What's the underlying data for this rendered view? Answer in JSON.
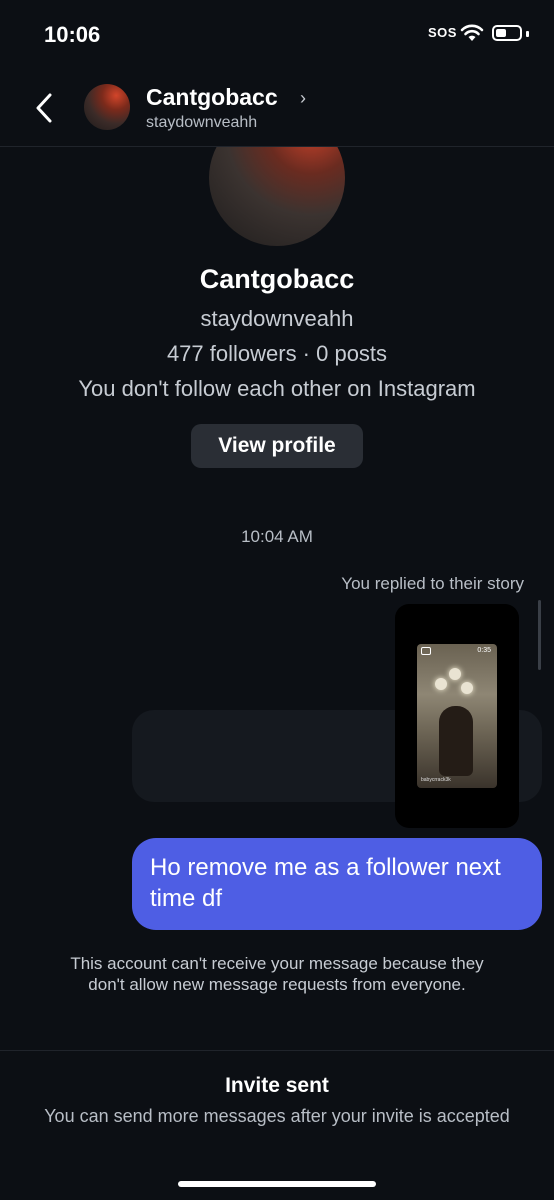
{
  "status_bar": {
    "time": "10:06",
    "sos": "SOS",
    "icons": [
      "wifi-icon",
      "battery-icon"
    ]
  },
  "header": {
    "back_icon": "chevron-left-icon",
    "name": "Cantgobacc",
    "chevron": "›",
    "handle": "staydownveahh"
  },
  "profile": {
    "name": "Cantgobacc",
    "handle": "staydownveahh",
    "stats": "477 followers · 0 posts",
    "follow_status": "You don't follow each other on Instagram",
    "view_profile_label": "View profile"
  },
  "conversation": {
    "timestamp": "10:04 AM",
    "story_reply_label": "You replied to their story",
    "story_preview": {
      "time": "0:35",
      "handle": "babycrrack3k"
    },
    "message": "Ho remove me as a follower next time df",
    "error": "This account can't receive your message because they don't allow new message requests from everyone."
  },
  "footer": {
    "invite_title": "Invite sent",
    "invite_subtitle": "You can send more messages after your invite is accepted"
  },
  "colors": {
    "background": "#0c0f14",
    "message_bubble": "#4e5ee4",
    "button": "#2a2e35"
  }
}
